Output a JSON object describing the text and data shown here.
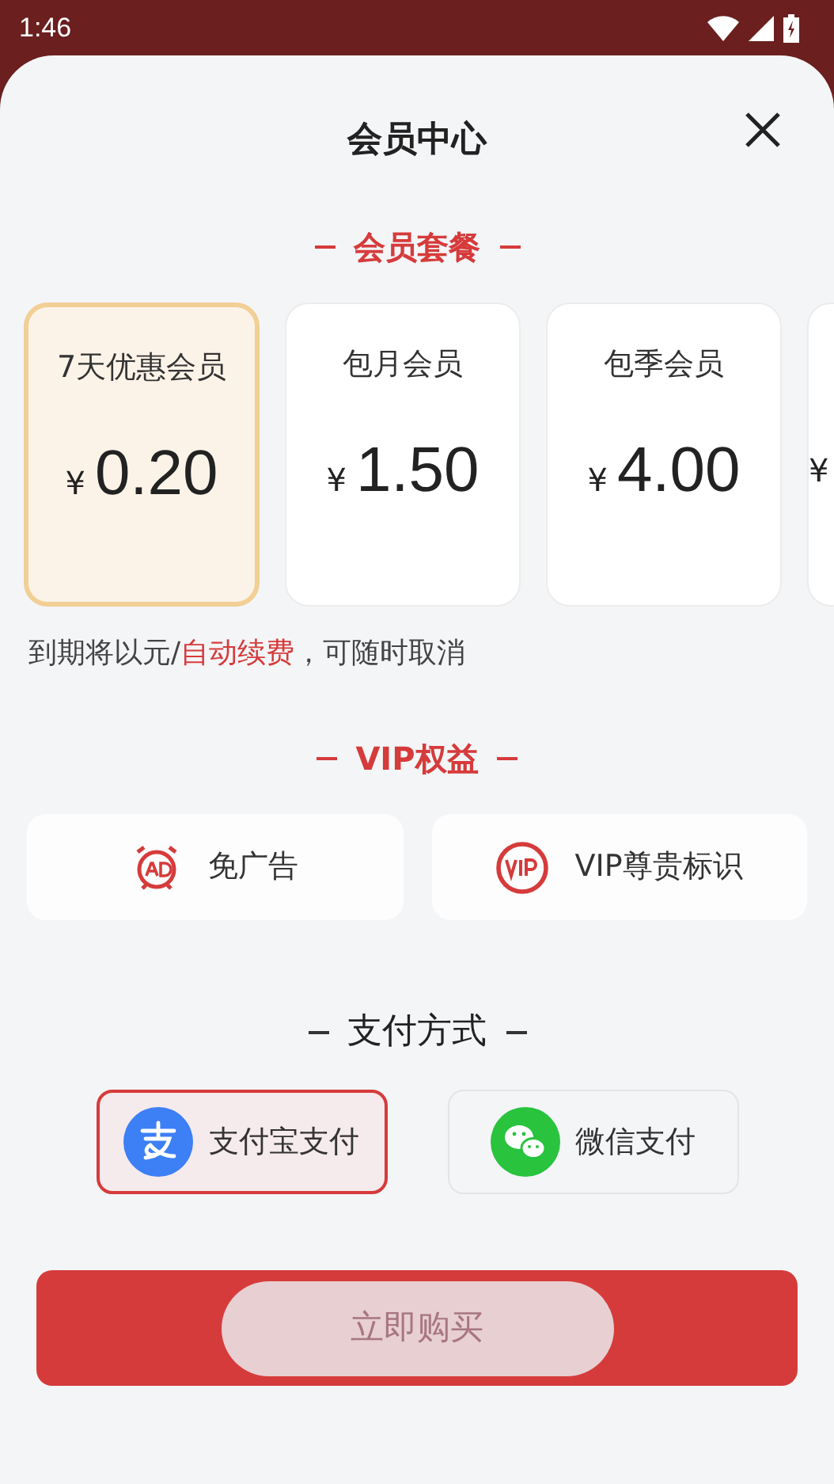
{
  "status_bar": {
    "time": "1:46"
  },
  "sheet": {
    "title": "会员中心"
  },
  "plans_section": {
    "heading": "会员套餐"
  },
  "plans": [
    {
      "name": "7天优惠会员",
      "currency": "¥",
      "price": "0.20",
      "selected": true
    },
    {
      "name": "包月会员",
      "currency": "¥",
      "price": "1.50",
      "selected": false
    },
    {
      "name": "包季会员",
      "currency": "¥",
      "price": "4.00",
      "selected": false
    },
    {
      "currency": "¥",
      "selected": false
    }
  ],
  "renewal_note": {
    "before": "到期将以元/",
    "link": "自动续费",
    "after": "，可随时取消"
  },
  "benefits_section": {
    "heading": "VIP权益"
  },
  "benefits": [
    {
      "kind": "ad",
      "label": "免广告"
    },
    {
      "kind": "vip",
      "label": "VIP尊贵标识"
    }
  ],
  "payment_section": {
    "heading": "支付方式"
  },
  "payment_methods": [
    {
      "kind": "alipay",
      "label": "支付宝支付",
      "selected": true
    },
    {
      "kind": "wechat",
      "label": "微信支付",
      "selected": false
    }
  ],
  "buy_button": {
    "label": "立即购买",
    "disabled": true
  }
}
